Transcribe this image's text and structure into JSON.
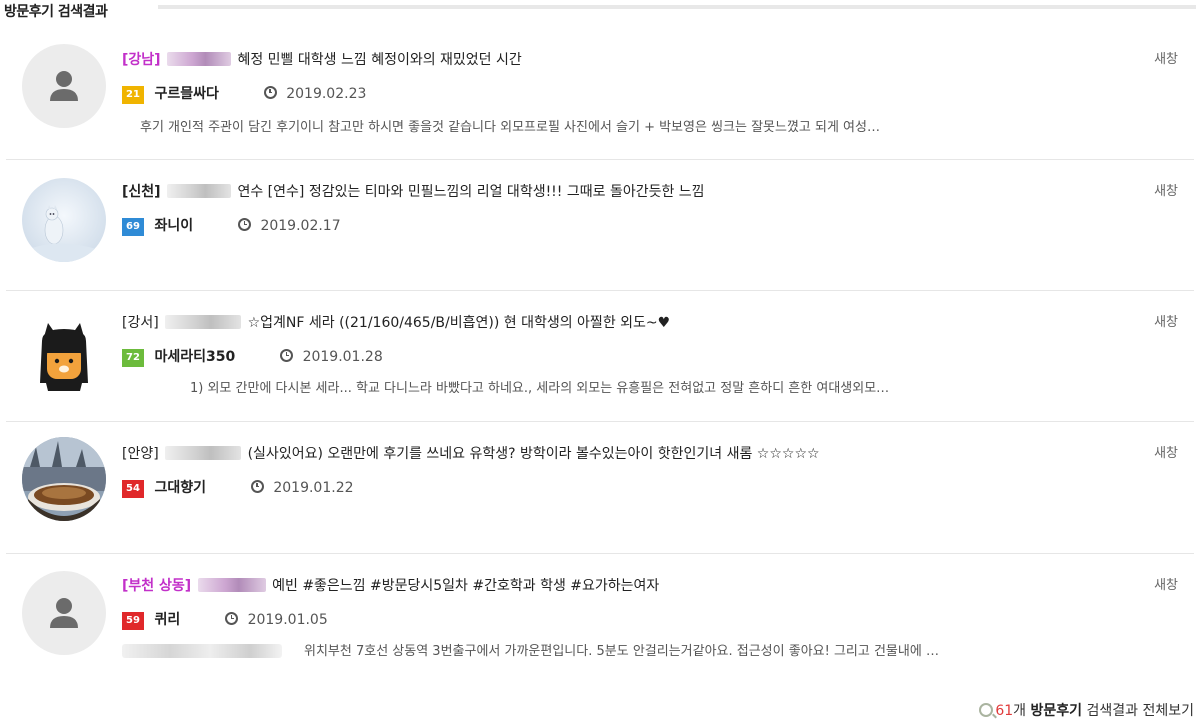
{
  "section": {
    "title": "방문후기 검색결과"
  },
  "newtab_label": "새창",
  "reviews": [
    {
      "region": "[강남]",
      "title": "혜정 민삘 대학생 느낌 혜정이와의 재밌었던 시간",
      "level": "21",
      "level_color": "#f0b400",
      "nick": "구르믈싸다",
      "date": "2019.02.23",
      "snippet": "후기 개인적 주관이 담긴 후기이니 참고만 하시면 좋을것 같습니다      외모프로필 사진에서 슬기 + 박보영은 씽크는 잘못느꼈고 되게 여성…"
    },
    {
      "region": "[신천]",
      "title": "연수 [연수] 정감있는 티마와 민필느낌의 리얼 대학생!!! 그때로 돌아간듯한 느낌",
      "level": "69",
      "level_color": "#2f8bd6",
      "nick": "좌니이",
      "date": "2019.02.17",
      "snippet": ""
    },
    {
      "region": "[강서]",
      "title": "☆업계NF 세라 ((21/160/465/B/비흡연)) 현 대학생의 아찔한 외도~♥",
      "level": "72",
      "level_color": "#6cbb3c",
      "nick": "마세라티350",
      "date": "2019.01.28",
      "snippet": "1) 외모     간만에 다시본 세라... 학교 다니느라 바빴다고 하네요., 세라의 외모는 유흥필은 전혀없고 정말 흔하디 흔한 여대생외모…"
    },
    {
      "region": "[안양]",
      "title": "(실사있어요) 오랜만에 후기를 쓰네요 유학생? 방학이라 볼수있는아이 핫한인기녀 새롬 ☆☆☆☆☆",
      "level": "54",
      "level_color": "#e0282a",
      "nick": "그대향기",
      "date": "2019.01.22",
      "snippet": ""
    },
    {
      "region": "[부천 상동]",
      "title": "예빈 #좋은느낌 #방문당시5일차 #간호학과 학생 #요가하는여자",
      "level": "59",
      "level_color": "#e0282a",
      "nick": "퀴리",
      "date": "2019.01.05",
      "snippet": "위치부천 7호선 상동역 3번출구에서 가까운편입니다. 5분도 안걸리는거같아요. 접근성이 좋아요! 그리고 건물내에 …"
    }
  ],
  "footer": {
    "count": "61",
    "count_suffix": "개",
    "strong": "방문후기",
    "rest": "검색결과 전체보기"
  },
  "icons": [
    "person-placeholder-icon",
    "clock-icon",
    "magnifier-plus-icon"
  ]
}
